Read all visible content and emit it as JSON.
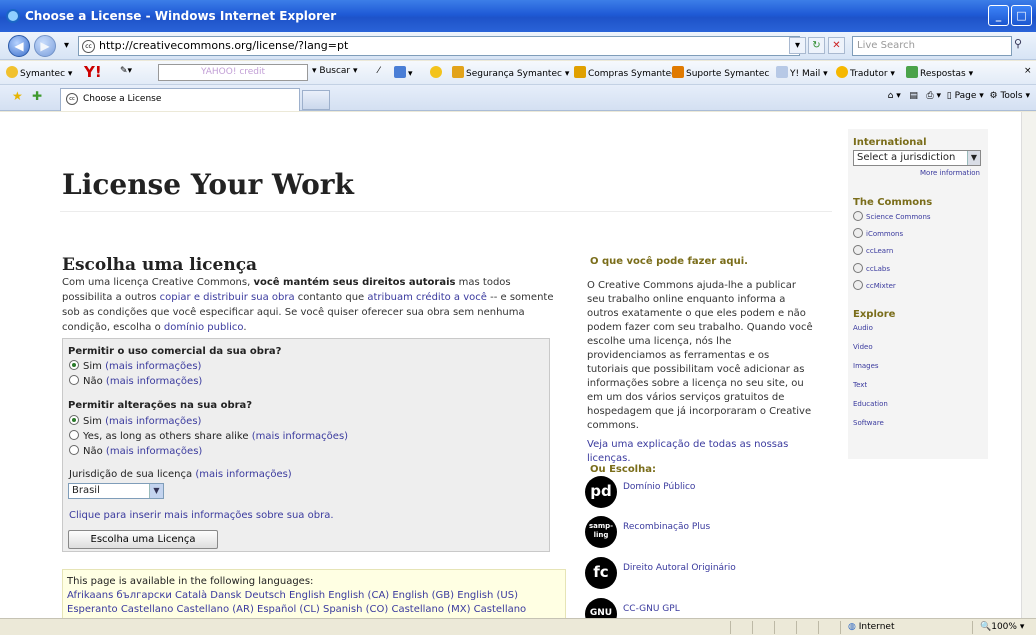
{
  "window": {
    "title": "Choose a License - Windows Internet Explorer",
    "buttons": [
      "_",
      "□"
    ]
  },
  "address": {
    "url": "http://creativecommons.org/license/?lang=pt",
    "search_placeholder": "Live Search"
  },
  "toolbar": {
    "symantec": "Symantec",
    "yahoo_box": "YAHOO! credit",
    "buscar": "Buscar",
    "seguranca": "Segurança Symantec",
    "compras": "Compras Symantec",
    "suporte": "Suporte Symantec",
    "ymail": "Y! Mail",
    "tradutor": "Tradutor",
    "respostas": "Respostas"
  },
  "tabs": {
    "active": "Choose a License",
    "page_menu": "Page",
    "tools_menu": "Tools"
  },
  "page": {
    "title": "License Your Work",
    "heading": "Escolha uma licença",
    "intro_1": "Com uma licença Creative Commons, ",
    "intro_bold": "você mantém seus direitos autorais",
    "intro_2": " mas todos possibilita a outros ",
    "intro_link1": "copiar e distribuir sua obra",
    "intro_3": " contanto que ",
    "intro_link2": "atribuam crédito a você",
    "intro_4": " -- e somente sob as condições que você especificar aqui. Se você quiser oferecer sua obra sem nenhuma condição, escolha o ",
    "intro_link3": "domínio publico",
    "intro_5": "."
  },
  "form": {
    "q1": "Permitir o uso comercial da sua obra?",
    "q1_opts": [
      {
        "label": "Sim",
        "more": "(mais informações)",
        "checked": true
      },
      {
        "label": "Não",
        "more": "(mais informações)",
        "checked": false
      }
    ],
    "q2": "Permitir alterações na sua obra?",
    "q2_opts": [
      {
        "label": "Sim",
        "more": "(mais informações)",
        "checked": true
      },
      {
        "label": "Yes, as long as others share alike",
        "more": "(mais informações)",
        "checked": false
      },
      {
        "label": "Não",
        "more": "(mais informações)",
        "checked": false
      }
    ],
    "jurisdiction_label": "Jurisdição de sua licença",
    "jurisdiction_more": "(mais informações)",
    "jurisdiction_value": "Brasil",
    "extra_info_link": "Clique para inserir mais informações sobre sua obra.",
    "submit": "Escolha uma Licença"
  },
  "languages": {
    "intro": "This page is available in the following languages:",
    "line1": "Afrikaans български Català Dansk Deutsch English English (CA) English (GB) English (US)",
    "line2": "Esperanto Castellano Castellano (AR) Español (CL) Spanish (CO) Castellano (MX) Castellano"
  },
  "right": {
    "heading": "O que você pode fazer aqui.",
    "para": "O Creative Commons ajuda-lhe a publicar seu trabalho online enquanto informa a outros exatamente o que eles podem e não podem fazer com seu trabalho. Quando você escolhe uma licença, nós lhe providenciamos as ferramentas e os tutoriais que possibilitam você adicionar as informações sobre a licença no seu site, ou em um dos vários serviços gratuitos de hospedagem que já incorporaram o Creative commons.",
    "explain_link": "Veja uma explicação de todas as nossas licenças.",
    "or_choose": "Ou Escolha:",
    "licenses": [
      {
        "badge": "pd",
        "name": "Domínio Público"
      },
      {
        "badge": "samp-ling",
        "name": "Recombinação Plus"
      },
      {
        "badge": "fc",
        "name": "Direito Autoral Originário"
      },
      {
        "badge": "GNU",
        "name": "CC-GNU GPL"
      }
    ]
  },
  "sidebar": {
    "international": "International",
    "select": "Select a jurisdiction",
    "more": "More information",
    "commons": "The Commons",
    "commons_links": [
      "Science Commons",
      "iCommons",
      "ccLearn",
      "ccLabs",
      "ccMixter"
    ],
    "explore": "Explore",
    "explore_links": [
      "Audio",
      "Video",
      "Images",
      "Text",
      "Education",
      "Software"
    ]
  },
  "status": {
    "zone": "Internet",
    "zoom": "100%"
  }
}
